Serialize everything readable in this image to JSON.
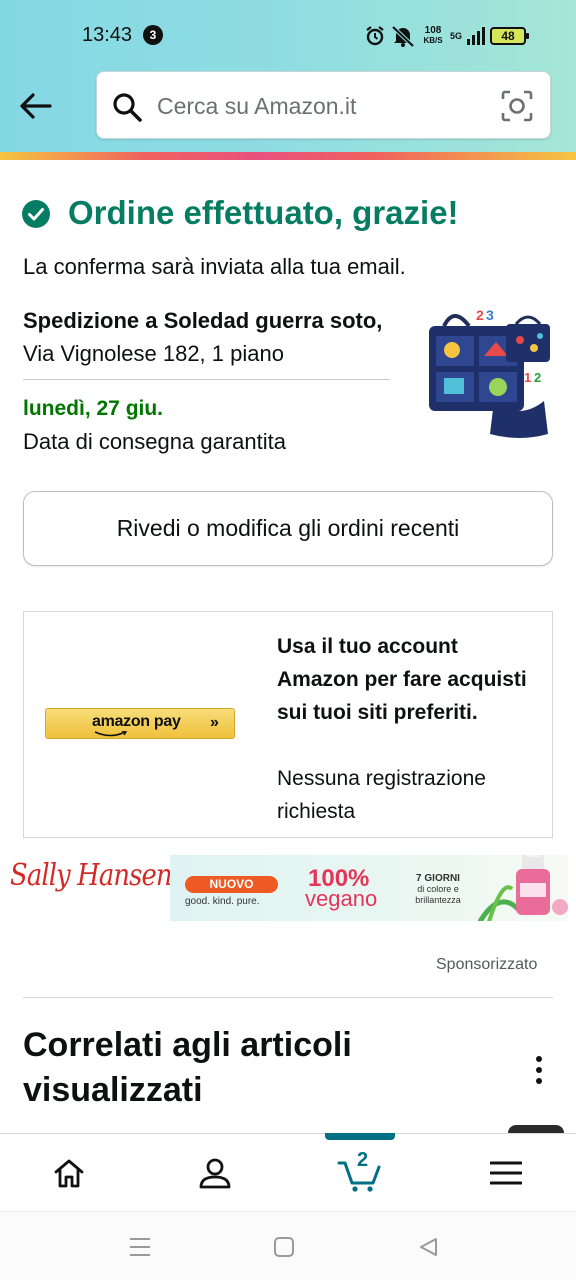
{
  "status_bar": {
    "time": "13:43",
    "notification_count": "3",
    "speed_value": "108",
    "speed_unit": "KB/S",
    "network": "5G",
    "battery": "48",
    "icons": [
      "alarm-icon",
      "mute-icon",
      "signal-icon",
      "battery-icon"
    ]
  },
  "header": {
    "search_placeholder": "Cerca su Amazon.it",
    "icons": [
      "back-arrow-icon",
      "search-icon",
      "camera-icon"
    ]
  },
  "confirmation": {
    "title": "Ordine effettuato, grazie!",
    "subtitle": "La conferma sarà inviata alla tua email.",
    "ship_label": "Spedizione a Soledad guerra soto,",
    "ship_address": " Via Vignolese 182, 1 piano",
    "delivery_date": "lunedì, 27 giu.",
    "delivery_note": "Data di consegna garantita",
    "review_button": "Rivedi o modifica gli ordini recenti"
  },
  "amazon_pay": {
    "logo_text": "amazon pay",
    "arrows": "»",
    "headline": "Usa il tuo account Amazon per fare acquisti sui tuoi siti preferiti.",
    "sub": "Nessuna registrazione richiesta"
  },
  "ad": {
    "brand": "Sally Hansen.",
    "badge": "NUOVO",
    "tagline": "good. kind. pure.",
    "percent": "100%",
    "vegan": "vegano",
    "days_title": "7 GIORNI",
    "days_text": "di colore e brillantezza",
    "sponsored": "Sponsorizzato"
  },
  "related": {
    "title": "Correlati agli articoli visualizzati"
  },
  "bottom_nav": {
    "items": [
      "home",
      "account",
      "cart",
      "menu"
    ],
    "active": "cart",
    "cart_count": "2"
  },
  "colors": {
    "success": "#067d62",
    "delivery": "#007600",
    "nav_accent": "#007185",
    "ad_red": "#d42a27"
  }
}
